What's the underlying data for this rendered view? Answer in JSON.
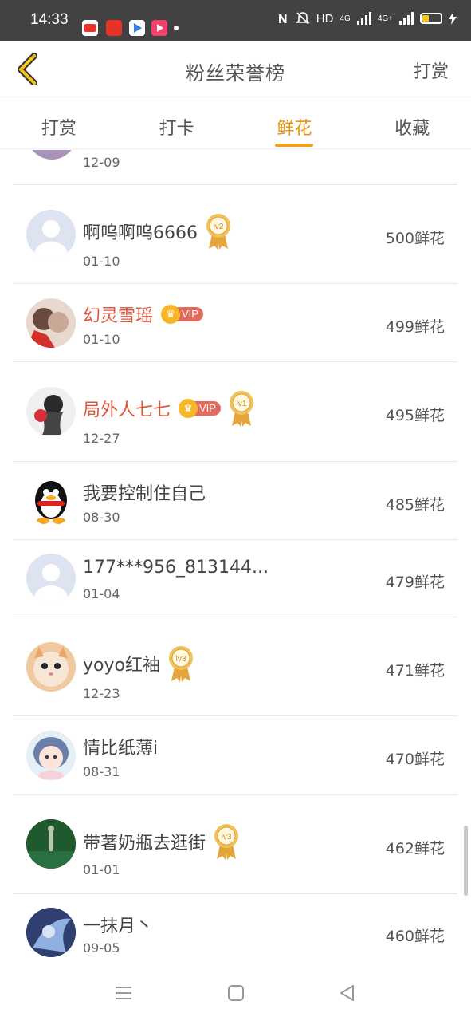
{
  "status_bar": {
    "time": "14:33",
    "network": "HD",
    "signal1": "4G",
    "signal2": "4G+",
    "icons": [
      "nfc-icon",
      "bell-mute-icon",
      "battery-icon",
      "charging-icon"
    ]
  },
  "header": {
    "back_icon": "chevron-left-icon",
    "title": "粉丝荣誉榜",
    "action": "打赏"
  },
  "tabs": [
    {
      "label": "打赏",
      "active": false
    },
    {
      "label": "打卡",
      "active": false
    },
    {
      "label": "鲜花",
      "active": true
    },
    {
      "label": "收藏",
      "active": false
    }
  ],
  "partial_row": {
    "date": "12-09"
  },
  "rows": [
    {
      "name": "啊呜啊呜6666",
      "date": "01-10",
      "amount": "500鲜花",
      "vip": false,
      "medal": "lv2"
    },
    {
      "name": "幻灵雪瑶",
      "date": "01-10",
      "amount": "499鲜花",
      "vip": true,
      "medal": ""
    },
    {
      "name": "局外人七七",
      "date": "12-27",
      "amount": "495鲜花",
      "vip": true,
      "medal": "lv1"
    },
    {
      "name": "我要控制住自己",
      "date": "08-30",
      "amount": "485鲜花",
      "vip": false,
      "medal": ""
    },
    {
      "name": "177***956_813144...",
      "date": "01-04",
      "amount": "479鲜花",
      "vip": false,
      "medal": ""
    },
    {
      "name": "yoyo红袖",
      "date": "12-23",
      "amount": "471鲜花",
      "vip": false,
      "medal": "lv3"
    },
    {
      "name": "情比纸薄i",
      "date": "08-31",
      "amount": "470鲜花",
      "vip": false,
      "medal": ""
    },
    {
      "name": "带著奶瓶去逛街",
      "date": "01-01",
      "amount": "462鲜花",
      "vip": false,
      "medal": "lv3"
    },
    {
      "name": "一抹月丶",
      "date": "09-05",
      "amount": "460鲜花",
      "vip": false,
      "medal": ""
    }
  ],
  "vip_label": "VIP",
  "colors": {
    "accent": "#f0a020",
    "vip_name": "#e0553d",
    "vip_badge": "#e46a5e",
    "status_bar": "#424242"
  }
}
